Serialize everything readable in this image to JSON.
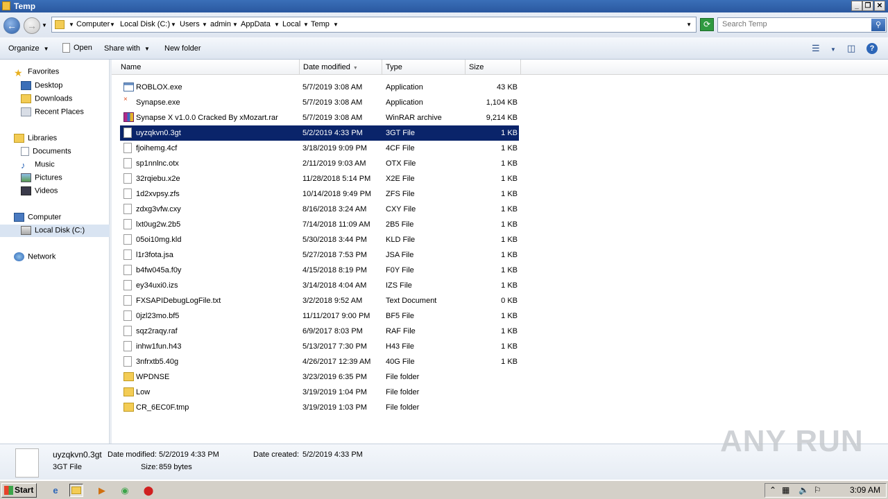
{
  "window": {
    "title": "Temp",
    "min": "_",
    "max": "❐",
    "close": "✕"
  },
  "address": {
    "breadcrumbs": [
      "Computer",
      "Local Disk (C:)",
      "Users",
      "admin",
      "AppData",
      "Local",
      "Temp"
    ],
    "search_placeholder": "Search Temp"
  },
  "toolbar": {
    "organize": "Organize",
    "open": "Open",
    "share_with": "Share with",
    "new_folder": "New folder"
  },
  "nav": {
    "favorites": "Favorites",
    "desktop": "Desktop",
    "downloads": "Downloads",
    "recent_places": "Recent Places",
    "libraries": "Libraries",
    "documents": "Documents",
    "music": "Music",
    "pictures": "Pictures",
    "videos": "Videos",
    "computer": "Computer",
    "local_disk": "Local Disk (C:)",
    "network": "Network"
  },
  "columns": {
    "name": "Name",
    "date": "Date modified",
    "type": "Type",
    "size": "Size"
  },
  "files": [
    {
      "name": "ROBLOX.exe",
      "date": "5/7/2019 3:08 AM",
      "type": "Application",
      "size": "43 KB",
      "icon": "app"
    },
    {
      "name": "Synapse.exe",
      "date": "5/7/2019 3:08 AM",
      "type": "Application",
      "size": "1,104 KB",
      "icon": "syn"
    },
    {
      "name": "Synapse X v1.0.0 Cracked By xMozart.rar",
      "date": "5/7/2019 3:08 AM",
      "type": "WinRAR archive",
      "size": "9,214 KB",
      "icon": "rar"
    },
    {
      "name": "uyzqkvn0.3gt",
      "date": "5/2/2019 4:33 PM",
      "type": "3GT File",
      "size": "1 KB",
      "icon": "file",
      "selected": true
    },
    {
      "name": "fjoihemg.4cf",
      "date": "3/18/2019 9:09 PM",
      "type": "4CF File",
      "size": "1 KB",
      "icon": "file"
    },
    {
      "name": "sp1nnlnc.otx",
      "date": "2/11/2019 9:03 AM",
      "type": "OTX File",
      "size": "1 KB",
      "icon": "file"
    },
    {
      "name": "32rqiebu.x2e",
      "date": "11/28/2018 5:14 PM",
      "type": "X2E File",
      "size": "1 KB",
      "icon": "file"
    },
    {
      "name": "1d2xvpsy.zfs",
      "date": "10/14/2018 9:49 PM",
      "type": "ZFS File",
      "size": "1 KB",
      "icon": "file"
    },
    {
      "name": "zdxg3vfw.cxy",
      "date": "8/16/2018 3:24 AM",
      "type": "CXY File",
      "size": "1 KB",
      "icon": "file"
    },
    {
      "name": "lxt0ug2w.2b5",
      "date": "7/14/2018 11:09 AM",
      "type": "2B5 File",
      "size": "1 KB",
      "icon": "file"
    },
    {
      "name": "05oi10mg.kld",
      "date": "5/30/2018 3:44 PM",
      "type": "KLD File",
      "size": "1 KB",
      "icon": "file"
    },
    {
      "name": "l1r3fota.jsa",
      "date": "5/27/2018 7:53 PM",
      "type": "JSA File",
      "size": "1 KB",
      "icon": "file"
    },
    {
      "name": "b4fw045a.f0y",
      "date": "4/15/2018 8:19 PM",
      "type": "F0Y File",
      "size": "1 KB",
      "icon": "file"
    },
    {
      "name": "ey34uxi0.izs",
      "date": "3/14/2018 4:04 AM",
      "type": "IZS File",
      "size": "1 KB",
      "icon": "file"
    },
    {
      "name": "FXSAPIDebugLogFile.txt",
      "date": "3/2/2018 9:52 AM",
      "type": "Text Document",
      "size": "0 KB",
      "icon": "file"
    },
    {
      "name": "0jzl23mo.bf5",
      "date": "11/11/2017 9:00 PM",
      "type": "BF5 File",
      "size": "1 KB",
      "icon": "file"
    },
    {
      "name": "sqz2raqy.raf",
      "date": "6/9/2017 8:03 PM",
      "type": "RAF File",
      "size": "1 KB",
      "icon": "file"
    },
    {
      "name": "inhw1fun.h43",
      "date": "5/13/2017 7:30 PM",
      "type": "H43 File",
      "size": "1 KB",
      "icon": "file"
    },
    {
      "name": "3nfrxtb5.40g",
      "date": "4/26/2017 12:39 AM",
      "type": "40G File",
      "size": "1 KB",
      "icon": "file"
    },
    {
      "name": "WPDNSE",
      "date": "3/23/2019 6:35 PM",
      "type": "File folder",
      "size": "",
      "icon": "folder"
    },
    {
      "name": "Low",
      "date": "3/19/2019 1:04 PM",
      "type": "File folder",
      "size": "",
      "icon": "folder"
    },
    {
      "name": "CR_6EC0F.tmp",
      "date": "3/19/2019 1:03 PM",
      "type": "File folder",
      "size": "",
      "icon": "folder"
    }
  ],
  "details": {
    "filename": "uyzqkvn0.3gt",
    "filetype": "3GT File",
    "modified_label": "Date modified:",
    "modified_value": "5/2/2019 4:33 PM",
    "created_label": "Date created:",
    "created_value": "5/2/2019 4:33 PM",
    "size_label": "Size:",
    "size_value": "859 bytes"
  },
  "watermark": "ANY RUN",
  "taskbar": {
    "start": "Start",
    "clock": "3:09 AM"
  }
}
